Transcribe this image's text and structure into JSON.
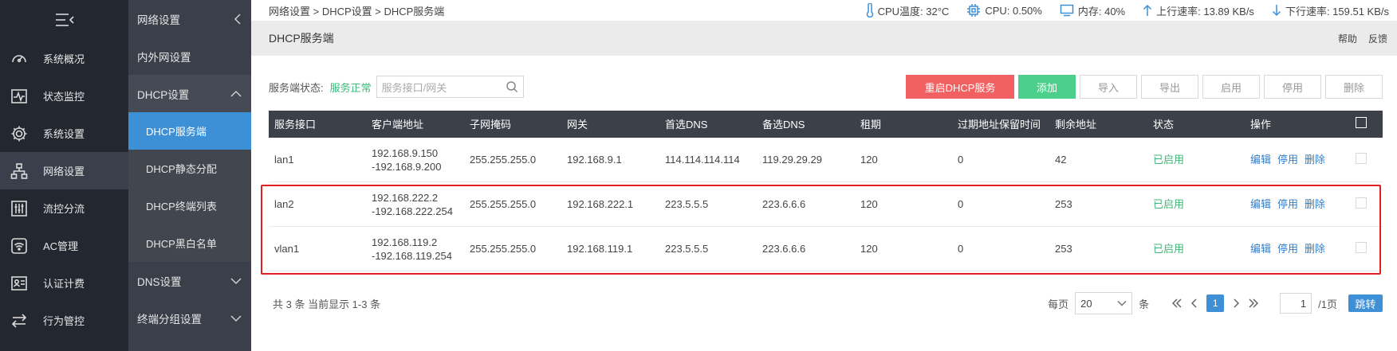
{
  "breadcrumb": "网络设置 > DHCP设置 > DHCP服务端",
  "stats": {
    "cpu_temp": "CPU温度: 32°C",
    "cpu": "CPU: 0.50%",
    "mem": "内存: 40%",
    "up": "上行速率: 13.89 KB/s",
    "down": "下行速率: 159.51 KB/s"
  },
  "page": {
    "title": "DHCP服务端",
    "help": "帮助",
    "feedback": "反馈"
  },
  "nav1": {
    "items": [
      {
        "label": "系统概况",
        "icon": "gauge-icon"
      },
      {
        "label": "状态监控",
        "icon": "pulse-icon"
      },
      {
        "label": "系统设置",
        "icon": "gear-icon"
      },
      {
        "label": "网络设置",
        "icon": "network-icon"
      },
      {
        "label": "流控分流",
        "icon": "sliders-icon"
      },
      {
        "label": "AC管理",
        "icon": "wifi-icon"
      },
      {
        "label": "认证计费",
        "icon": "id-card-icon"
      },
      {
        "label": "行为管控",
        "icon": "arrows-icon"
      }
    ]
  },
  "nav2": {
    "header": "网络设置",
    "wan": "内外网设置",
    "dhcp": "DHCP设置",
    "dhcp_subs": [
      "DHCP服务端",
      "DHCP静态分配",
      "DHCP终端列表",
      "DHCP黑白名单"
    ],
    "dns": "DNS设置",
    "term_group": "终端分组设置"
  },
  "toolbar": {
    "status_label": "服务端状态:",
    "status_value": "服务正常",
    "search_placeholder": "服务接口/网关",
    "restart": "重启DHCP服务",
    "add": "添加",
    "import": "导入",
    "export": "导出",
    "enable": "启用",
    "disable": "停用",
    "delete": "删除"
  },
  "table": {
    "headers": [
      "服务接口",
      "客户端地址",
      "子网掩码",
      "网关",
      "首选DNS",
      "备选DNS",
      "租期",
      "过期地址保留时间",
      "剩余地址",
      "状态",
      "操作"
    ],
    "rows": [
      {
        "iface": "lan1",
        "range1": "192.168.9.150",
        "range2": "-192.168.9.200",
        "mask": "255.255.255.0",
        "gw": "192.168.9.1",
        "dns1": "114.114.114.114",
        "dns2": "119.29.29.29",
        "lease": "120",
        "keep": "0",
        "left": "42",
        "status": "已启用"
      },
      {
        "iface": "lan2",
        "range1": "192.168.222.2",
        "range2": "-192.168.222.254",
        "mask": "255.255.255.0",
        "gw": "192.168.222.1",
        "dns1": "223.5.5.5",
        "dns2": "223.6.6.6",
        "lease": "120",
        "keep": "0",
        "left": "253",
        "status": "已启用"
      },
      {
        "iface": "vlan1",
        "range1": "192.168.119.2",
        "range2": "-192.168.119.254",
        "mask": "255.255.255.0",
        "gw": "192.168.119.1",
        "dns1": "223.5.5.5",
        "dns2": "223.6.6.6",
        "lease": "120",
        "keep": "0",
        "left": "253",
        "status": "已启用"
      }
    ],
    "ops": {
      "edit": "编辑",
      "disable": "停用",
      "delete": "删除"
    }
  },
  "footer": {
    "summary": "共 3 条 当前显示 1-3 条",
    "per_page_label": "每页",
    "per_page": "20",
    "unit": "条",
    "current_page": "1",
    "page_input": "1",
    "total_pages": "/1页",
    "jump": "跳转"
  }
}
